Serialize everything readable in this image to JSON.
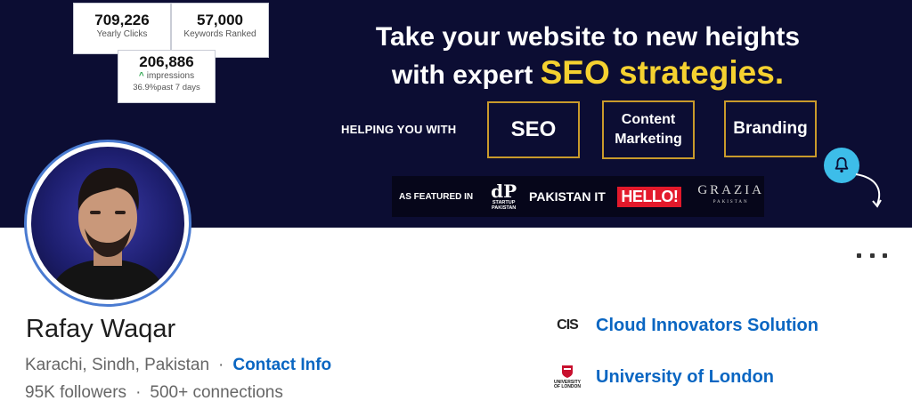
{
  "banner": {
    "stats": {
      "yearly_clicks_value": "709,226",
      "yearly_clicks_label": "Yearly Clicks",
      "keywords_value": "57,000",
      "keywords_label": "Keywords Ranked",
      "impressions_value": "206,886",
      "impressions_label": "impressions",
      "impressions_trend": "36.9%past 7 days"
    },
    "headline_line1": "Take your website to new heights",
    "headline_line2_prefix": "with expert ",
    "headline_accent": "SEO strategies.",
    "helping_label": "HELPING YOU WITH",
    "services": [
      "SEO",
      "Content Marketing",
      "Branding"
    ],
    "services_content_line1": "Content",
    "services_content_line2": "Marketing",
    "featured_label": "AS FEATURED IN",
    "featured_startup_mark": "dP",
    "featured_startup_line1": "STARTUP",
    "featured_startup_line2": "PAKISTAN",
    "featured_pakistan_it": "PAKISTAN IT",
    "featured_hello": "HELLO!",
    "featured_grazia": "GRAZIA",
    "featured_grazia_sub": "PAKISTAN",
    "accent_color": "#f5d130",
    "background_color": "#0c0d33",
    "bell_icon": "bell-icon",
    "bell_color": "#3dbde9"
  },
  "profile": {
    "name": "Rafay Waqar",
    "location": "Karachi, Sindh, Pakistan",
    "separator": "·",
    "contact_info": "Contact Info",
    "followers": "95K followers",
    "connections": "500+ connections",
    "more_icon": "more-horizontal-icon"
  },
  "organizations": [
    {
      "name": "Cloud Innovators Solution",
      "logo_text": "CIS"
    },
    {
      "name": "University of London",
      "logo_text_line1": "UNIVERSITY",
      "logo_text_line2": "OF LONDON"
    }
  ],
  "link_color": "#0a66c2"
}
